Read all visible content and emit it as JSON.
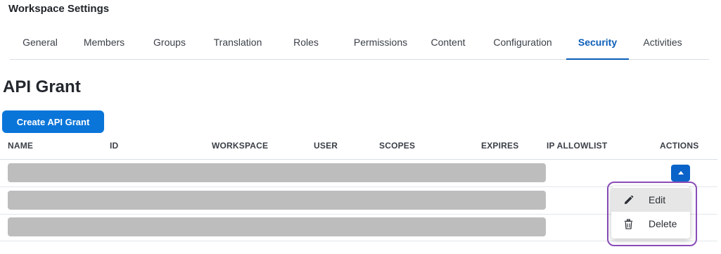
{
  "header": {
    "title": "Workspace Settings"
  },
  "tabs": [
    {
      "label": "General"
    },
    {
      "label": "Members"
    },
    {
      "label": "Groups"
    },
    {
      "label": "Translation"
    },
    {
      "label": "Roles"
    },
    {
      "label": "Permissions"
    },
    {
      "label": "Content"
    },
    {
      "label": "Configuration"
    },
    {
      "label": "Security",
      "active": true
    },
    {
      "label": "Activities"
    }
  ],
  "section": {
    "title": "API Grant",
    "create_button": "Create API Grant"
  },
  "table": {
    "columns": [
      "NAME",
      "ID",
      "WORKSPACE",
      "USER",
      "SCOPES",
      "EXPIRES",
      "IP ALLOWLIST",
      "ACTIONS"
    ],
    "row_count": 3
  },
  "action_menu": {
    "items": [
      {
        "label": "Edit",
        "icon": "pencil-icon",
        "hovered": true
      },
      {
        "label": "Delete",
        "icon": "trash-icon"
      }
    ],
    "highlight_color": "#8a4db8"
  },
  "colors": {
    "accent": "#0a5db8",
    "button": "#0a75d9",
    "placeholder": "#bdbdbd"
  }
}
